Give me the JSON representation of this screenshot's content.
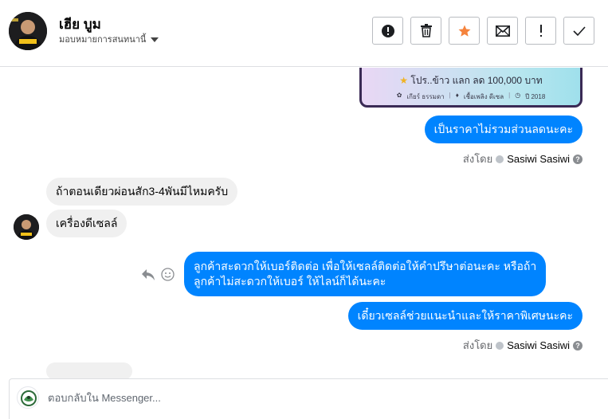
{
  "header": {
    "contact_name": "เฮีย บูม",
    "assign_label": "มอบหมายการสนทนานี้",
    "actions": [
      {
        "icon": "alert-circle-icon",
        "glyph": "!"
      },
      {
        "icon": "trash-icon",
        "glyph": ""
      },
      {
        "icon": "star-icon",
        "glyph": "★"
      },
      {
        "icon": "mail-icon",
        "glyph": "✉"
      },
      {
        "icon": "exclamation-icon",
        "glyph": "!"
      },
      {
        "icon": "checkmark-icon",
        "glyph": "✓"
      }
    ]
  },
  "image_card": {
    "promo_text": "โปร..ข้าว แลก ลด 100,000 บาท",
    "meta": [
      "เกียร์ ธรรมดา",
      "เชื้อเพลิง ดีเซล",
      "ปี 2018"
    ]
  },
  "messages": [
    {
      "direction": "out",
      "text": "เป็นราคาไม่รวมส่วนลดนะคะ"
    },
    {
      "direction": "in",
      "text": "ถ้าตอนเดียวผ่อนสัก3-4พันมีไหมครับ"
    },
    {
      "direction": "in",
      "text": "เครื่องดีเซลล์"
    },
    {
      "direction": "out",
      "line1": "ลูกค้าสะดวกให้เบอร์ติดต่อ เพื่อให้เซลล์ติดต่อให้คำปรึษาต่อนะคะ หรือถ้า",
      "line2": "ลูกค้าไม่สะดวกให้เบอร์ ให้ไลน์ก็ได้นะคะ"
    },
    {
      "direction": "out",
      "text": "เดี๋ยวเซลล์ช่วยแนะนำและให้ราคาพิเศษนะคะ"
    }
  ],
  "sent_by": {
    "prefix": "ส่งโดย",
    "agent": "Sasiwi Sasiwi"
  },
  "composer": {
    "placeholder": "ตอบกลับใน Messenger..."
  },
  "colors": {
    "outgoing_bubble": "#0084ff",
    "incoming_bubble": "#f0f0f0",
    "star_active": "#f5833c"
  }
}
